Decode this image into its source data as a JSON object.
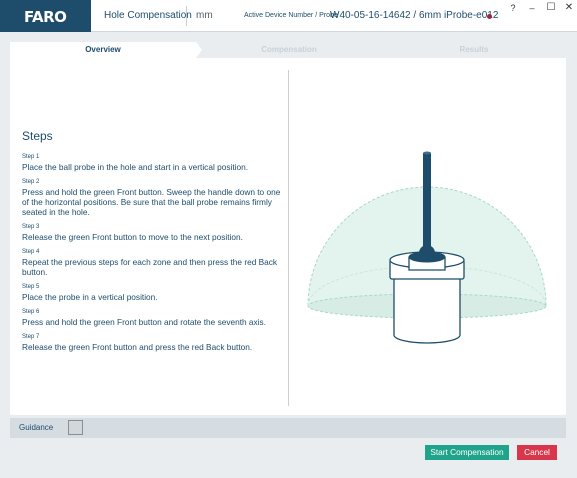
{
  "app": {
    "logo": "FARO",
    "title": "Hole Compensation",
    "unit": "mm",
    "device_label": "Active Device Number / Probe",
    "device_value": "W40-05-16-14642 / 6mm iProbe-e012"
  },
  "window_controls": {
    "help": "?",
    "minimize": "–",
    "maximize": "☐",
    "close": "✕"
  },
  "tabs": [
    {
      "label": "Overview",
      "active": true
    },
    {
      "label": "Compensation",
      "active": false
    },
    {
      "label": "Results",
      "active": false
    }
  ],
  "steps": {
    "heading": "Steps",
    "items": [
      {
        "num": "Step 1",
        "text": "Place the ball probe in the hole and start in a vertical position."
      },
      {
        "num": "Step 2",
        "text": "Press and hold the green Front button. Sweep the handle down to one of the horizontal positions. Be sure that the ball probe remains firmly seated in the hole."
      },
      {
        "num": "Step 3",
        "text": "Release the green Front button to move to the next position."
      },
      {
        "num": "Step 4",
        "text": "Repeat the previous steps for each zone and then press the red Back button."
      },
      {
        "num": "Step 5",
        "text": "Place the probe in a vertical position."
      },
      {
        "num": "Step 6",
        "text": "Press and hold the green Front button and rotate the seventh axis."
      },
      {
        "num": "Step 7",
        "text": "Release the green Front button and press the red Back button."
      }
    ]
  },
  "guidance": {
    "label": "Guidance",
    "checked": false
  },
  "actions": {
    "start": "Start Compensation",
    "cancel": "Cancel"
  },
  "colors": {
    "brand": "#1e4d6b",
    "start_button": "#1fa38a",
    "cancel_button": "#d8364a",
    "status_dot": "#9b2a3a",
    "hemisphere": "#e3f3ee"
  }
}
